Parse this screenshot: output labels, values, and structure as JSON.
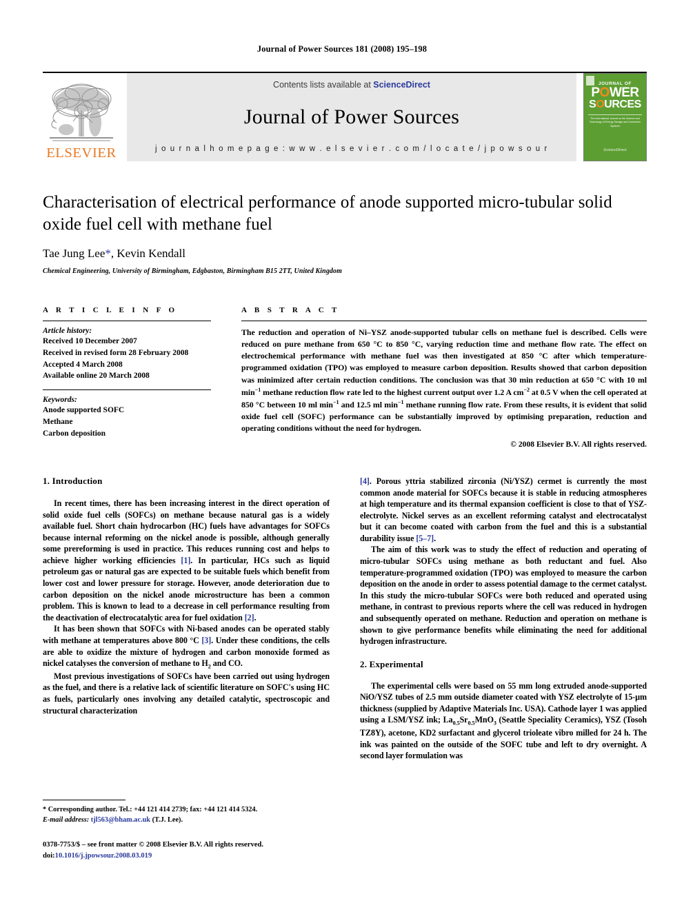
{
  "running_head": "Journal of Power Sources 181 (2008) 195–198",
  "masthead": {
    "elsevier_wordmark": "ELSEVIER",
    "contents_prefix": "Contents lists available at ",
    "sciencedirect": "ScienceDirect",
    "journal_title": "Journal of Power Sources",
    "homepage": "j o u r n a l   h o m e p a g e :   w w w . e l s e v i e r . c o m / l o c a t e / j p o w s o u r",
    "cover": {
      "line1": "JOURNAL OF",
      "line2_a": "P",
      "line2_o": "O",
      "line2_b": "WER",
      "line3_a": "S",
      "line3_o": "O",
      "line3_b": "URCES",
      "subtitle": "The International Journal on the Science and Technology of Energy Storage and Conversion Systems",
      "footer": "ScienceDirect"
    }
  },
  "article": {
    "title": "Characterisation of electrical performance of anode supported micro-tubular solid oxide fuel cell with methane fuel",
    "authors_pre": "Tae Jung Lee",
    "authors_star": "*",
    "authors_post": ", Kevin Kendall",
    "affiliation": "Chemical Engineering, University of Birmingham, Edgbaston, Birmingham B15 2TT, United Kingdom"
  },
  "article_info": {
    "heading": "A R T I C L E    I N F O",
    "history_label": "Article history:",
    "history": [
      "Received 10 December 2007",
      "Received in revised form 28 February 2008",
      "Accepted 4 March 2008",
      "Available online 20 March 2008"
    ],
    "keywords_label": "Keywords:",
    "keywords": [
      "Anode supported SOFC",
      "Methane",
      "Carbon deposition"
    ]
  },
  "abstract": {
    "heading": "A B S T R A C T",
    "part1": "The reduction and operation of Ni–YSZ anode-supported tubular cells on methane fuel is described. Cells were reduced on pure methane from 650 °C to 850 °C, varying reduction time and methane flow rate. The effect on electrochemical performance with methane fuel was then investigated at 850 °C after which temperature-programmed oxidation (TPO) was employed to measure carbon deposition. Results showed that carbon deposition was minimized after certain reduction conditions. The conclusion was that 30 min reduction at 650 °C with 10 ml min",
    "sup1": "−1",
    "part2": " methane reduction flow rate led to the highest current output over 1.2 A cm",
    "sup2": "−2",
    "part3": " at 0.5 V when the cell operated at 850 °C between 10 ml min",
    "sup3": "−1",
    "part4": " and 12.5 ml min",
    "sup4": "−1",
    "part5": " methane running flow rate. From these results, it is evident that solid oxide fuel cell (SOFC) performance can be substantially improved by optimising preparation, reduction and operating conditions without the need for hydrogen.",
    "copyright": "© 2008 Elsevier B.V. All rights reserved."
  },
  "sections": {
    "introduction_heading": "1.  Introduction",
    "experimental_heading": "2.  Experimental"
  },
  "intro": {
    "p1_a": "In recent times, there has been increasing interest in the direct operation of solid oxide fuel cells (SOFCs) on methane because natural gas is a widely available fuel. Short chain hydrocarbon (HC) fuels have advantages for SOFCs because internal reforming on the nickel anode is possible, although generally some prereforming is used in practice. This reduces running cost and helps to achieve higher working efficiencies ",
    "p1_cite1": "[1]",
    "p1_b": ". In particular, HCs such as liquid petroleum gas or natural gas are expected to be suitable fuels which benefit from lower cost and lower pressure for storage. However, anode deterioration due to carbon deposition on the nickel anode microstructure has been a common problem. This is known to lead to a decrease in cell performance resulting from the deactivation of electrocatalytic area for fuel oxidation ",
    "p1_cite2": "[2]",
    "p1_c": ".",
    "p2_a": "It has been shown that SOFCs with Ni-based anodes can be operated stably with methane at temperatures above 800 °C ",
    "p2_cite": "[3]",
    "p2_b": ". Under these conditions, the cells are able to oxidize the mixture of hydrogen and carbon monoxide formed as nickel catalyses the conversion of methane to H",
    "p2_sub": "2",
    "p2_c": " and CO.",
    "p3": "Most previous investigations of SOFCs have been carried out using hydrogen as the fuel, and there is a relative lack of scientific literature on SOFC's using HC as fuels, particularly ones involving any detailed catalytic, spectroscopic and structural characterization",
    "p4_cite": "[4]",
    "p4_a": ". Porous yttria stabilized zirconia (Ni/YSZ) cermet is currently the most common anode material for SOFCs because it is stable in reducing atmospheres at high temperature and its thermal expansion coefficient is close to that of YSZ-electrolyte. Nickel serves as an excellent reforming catalyst and electrocatalyst but it can become coated with carbon from the fuel and this is a substantial durability issue ",
    "p4_cite2": "[5–7]",
    "p4_b": ".",
    "p5": "The aim of this work was to study the effect of reduction and operating of micro-tubular SOFCs using methane as both reductant and fuel. Also temperature-programmed oxidation (TPO) was employed to measure the carbon deposition on the anode in order to assess potential damage to the cermet catalyst. In this study the micro-tubular SOFCs were both reduced and operated using methane, in contrast to previous reports where the cell was reduced in hydrogen and subsequently operated on methane. Reduction and operation on methane is shown to give performance benefits while eliminating the need for additional hydrogen infrastructure."
  },
  "experimental": {
    "p1_a": "The experimental cells were based on 55 mm long extruded anode-supported NiO/YSZ tubes of 2.5 mm outside diameter coated with YSZ electrolyte of 15-µm thickness (supplied by Adaptive Materials Inc. USA). Cathode layer 1 was applied using a LSM/YSZ ink; La",
    "sub1": "0.5",
    "p1_b": "Sr",
    "sub2": "0.5",
    "p1_c": "MnO",
    "sub3": "3",
    "p1_d": " (Seattle Speciality Ceramics), YSZ (Tosoh TZ8Y), acetone, KD2 surfactant and glycerol trioleate vibro milled for 24 h. The ink was painted on the outside of the SOFC tube and left to dry overnight. A second layer formulation was"
  },
  "footnote": {
    "corresponding": "* Corresponding author. Tel.: +44 121 414 2739; fax: +44 121 414 5324.",
    "email_label": "E-mail address:",
    "email": "tjl563@bham.ac.uk",
    "email_suffix": " (T.J. Lee)."
  },
  "issn": {
    "line1": "0378-7753/$ – see front matter © 2008 Elsevier B.V. All rights reserved.",
    "doi_label": "doi:",
    "doi": "10.1016/j.jpowsour.2008.03.019"
  }
}
